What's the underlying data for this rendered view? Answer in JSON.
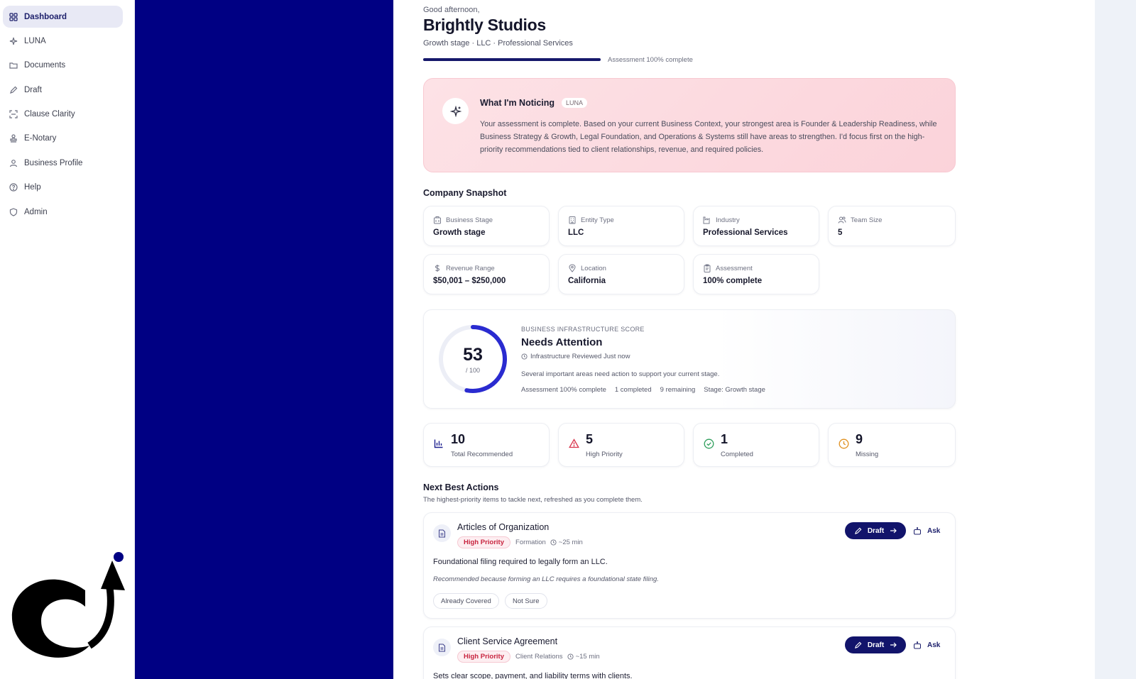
{
  "sidebar": {
    "items": [
      {
        "label": "Dashboard",
        "icon": "dashboard-icon",
        "active": true
      },
      {
        "label": "LUNA",
        "icon": "sparkle-icon"
      },
      {
        "label": "Documents",
        "icon": "folder-icon"
      },
      {
        "label": "Draft",
        "icon": "pen-icon"
      },
      {
        "label": "Clause Clarity",
        "icon": "scan-icon"
      },
      {
        "label": "E-Notary",
        "icon": "stamp-icon"
      },
      {
        "label": "Business Profile",
        "icon": "user-icon"
      },
      {
        "label": "Help",
        "icon": "help-icon"
      },
      {
        "label": "Admin",
        "icon": "shield-icon"
      }
    ]
  },
  "header": {
    "greeting": "Good afternoon,",
    "company": "Brightly Studios",
    "meta": "Growth stage · LLC · Professional Services",
    "progress_text": "Assessment 100% complete",
    "progress_value": 1.0
  },
  "notice": {
    "title": "What I'm Noticing",
    "badge": "LUNA",
    "body": "Your assessment is complete. Based on your current Business Context, your strongest area is Founder & Leadership Readiness, while Business Strategy & Growth, Legal Foundation, and Operations & Systems still have areas to strengthen. I'd focus first on the high-priority recommendations tied to client relationships, revenue, and required policies."
  },
  "snapshot": {
    "title": "Company Snapshot",
    "cards": [
      {
        "label": "Business Stage",
        "value": "Growth stage",
        "icon": "building-icon"
      },
      {
        "label": "Entity Type",
        "value": "LLC",
        "icon": "office-icon"
      },
      {
        "label": "Industry",
        "value": "Professional Services",
        "icon": "factory-icon"
      },
      {
        "label": "Team Size",
        "value": "5",
        "icon": "team-icon"
      },
      {
        "label": "Revenue Range",
        "value": "$50,001 – $250,000",
        "icon": "dollar-icon"
      },
      {
        "label": "Location",
        "value": "California",
        "icon": "pin-icon"
      },
      {
        "label": "Assessment",
        "value": "100% complete",
        "icon": "clipboard-icon"
      }
    ]
  },
  "score": {
    "kicker": "BUSINESS INFRASTRUCTURE SCORE",
    "value": "53",
    "fraction": 0.53,
    "denominator": "/ 100",
    "status": "Needs Attention",
    "reviewed": "Infrastructure Reviewed Just now",
    "description": "Several important areas need action to support your current stage.",
    "stats": [
      "Assessment 100% complete",
      "1 completed",
      "9 remaining",
      "Stage: Growth stage"
    ]
  },
  "stats": [
    {
      "value": "10",
      "label": "Total Recommended",
      "icon": "bar-chart-icon",
      "color": "#1c1f8f"
    },
    {
      "value": "5",
      "label": "High Priority",
      "icon": "warning-icon",
      "color": "#d8324a"
    },
    {
      "value": "1",
      "label": "Completed",
      "icon": "check-circle-icon",
      "color": "#2e9e5b"
    },
    {
      "value": "9",
      "label": "Missing",
      "icon": "clock-icon",
      "color": "#e0901f"
    }
  ],
  "next_actions": {
    "title": "Next Best Actions",
    "subtitle": "The highest-priority items to tackle next, refreshed as you complete them.",
    "draft_label": "Draft",
    "ask_label": "Ask",
    "items": [
      {
        "title": "Articles of Organization",
        "priority": "High Priority",
        "area": "Formation",
        "time": "~25 min",
        "description": "Foundational filing required to legally form an LLC.",
        "reason": "Recommended because forming an LLC requires a foundational state filing.",
        "chips": [
          "Already Covered",
          "Not Sure"
        ]
      },
      {
        "title": "Client Service Agreement",
        "priority": "High Priority",
        "area": "Client Relations",
        "time": "~15 min",
        "description": "Sets clear scope, payment, and liability terms with clients."
      }
    ]
  },
  "colors": {
    "brand": "#12146b",
    "band": "#000083",
    "alert_bg": "#fbd3da",
    "accent_ring": "#2a2bd0"
  }
}
